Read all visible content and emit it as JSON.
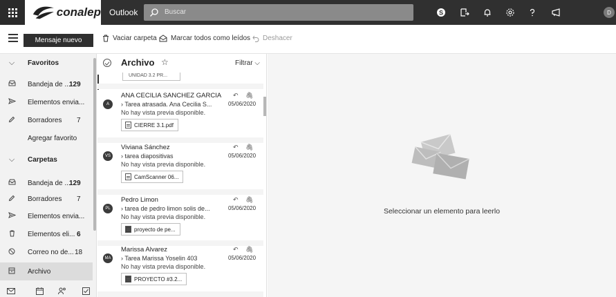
{
  "header": {
    "brand_name": "conalep",
    "app_name": "Outlook",
    "search_placeholder": "Buscar",
    "user_initials": "D",
    "icons": [
      "skype-icon",
      "translate-icon",
      "bell-icon",
      "gear-icon",
      "help-icon",
      "feedback-icon"
    ]
  },
  "toolbar": {
    "new_message": "Mensaje nuevo",
    "empty_folder": "Vaciar carpeta",
    "mark_all_read": "Marcar todos como leídos",
    "undo": "Deshacer"
  },
  "nav": {
    "favorites_header": "Favoritos",
    "favorites": [
      {
        "label": "Bandeja de ...",
        "count": "129",
        "icon": "inbox-icon"
      },
      {
        "label": "Elementos envia...",
        "count": "",
        "icon": "send-icon"
      },
      {
        "label": "Borradores",
        "count": "7",
        "icon": "pencil-icon"
      }
    ],
    "add_favorite": "Agregar favorito",
    "folders_header": "Carpetas",
    "folders": [
      {
        "label": "Bandeja de ...",
        "count": "129",
        "icon": "inbox-icon"
      },
      {
        "label": "Borradores",
        "count": "7",
        "icon": "pencil-icon"
      },
      {
        "label": "Elementos envia...",
        "count": "",
        "icon": "send-icon"
      },
      {
        "label": "Elementos eli...",
        "count": "6",
        "icon": "trash-icon"
      },
      {
        "label": "Correo no de...",
        "count": "18",
        "icon": "block-icon"
      },
      {
        "label": "Archivo",
        "count": "",
        "icon": "archive-icon"
      }
    ]
  },
  "list": {
    "title": "Archivo",
    "filter": "Filtrar",
    "partial_attachment": "UNIDAD 3.2 PR...",
    "messages": [
      {
        "initials": "A",
        "from": "ANA CECILIA SANCHEZ GARCIA",
        "subject": "Tarea atrasada. Ana Cecilia S...",
        "date": "05/06/2020",
        "preview": "No hay vista previa disponible.",
        "attachment": "CIERRE 3.1.pdf"
      },
      {
        "initials": "VS",
        "from": "Viviana Sánchez",
        "subject": "tarea diapositivas",
        "date": "05/06/2020",
        "preview": "No hay vista previa disponible.",
        "attachment": "CamScanner 06..."
      },
      {
        "initials": "PL",
        "from": "Pedro Limon",
        "subject": "tarea de pedro limon solis de...",
        "date": "05/06/2020",
        "preview": "No hay vista previa disponible.",
        "attachment": "proyecto de pe..."
      },
      {
        "initials": "MA",
        "from": "Marissa Alvarez",
        "subject": "Tarea Marissa Yoselin 403",
        "date": "05/06/2020",
        "preview": "No hay vista previa disponible.",
        "attachment": "PROYECTO #3.2..."
      }
    ]
  },
  "reading": {
    "empty_message": "Seleccionar un elemento para leerlo"
  }
}
